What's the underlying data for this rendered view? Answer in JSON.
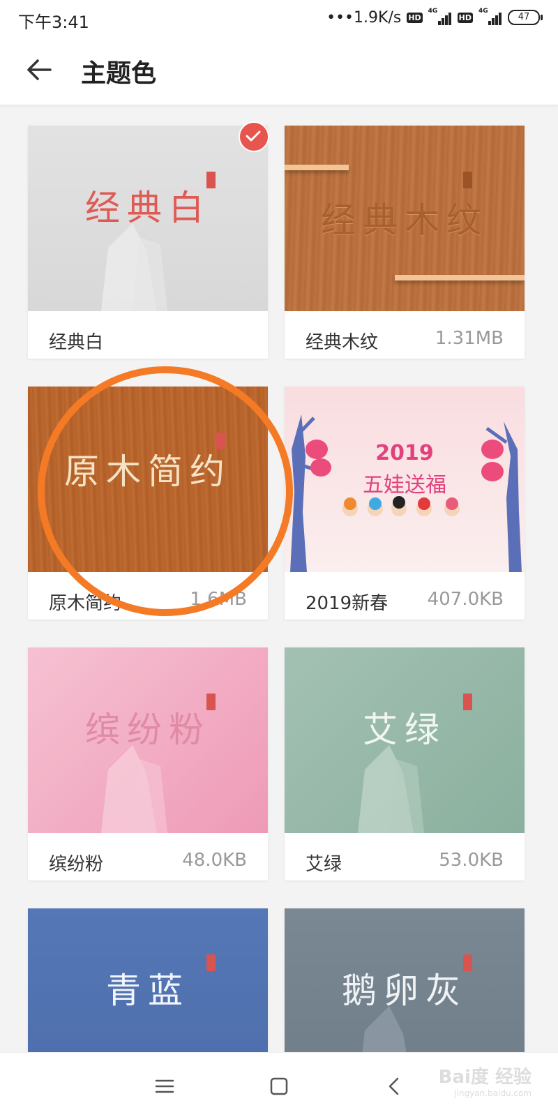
{
  "status_bar": {
    "time": "下午3:41",
    "network_speed": "•••1.9K/s",
    "hd_badge": "HD",
    "signal_label": "4G",
    "battery": "47"
  },
  "header": {
    "title": "主题色",
    "back_icon": "arrow-left-icon"
  },
  "themes": [
    {
      "thumb_text": "经典白",
      "name": "经典白",
      "size": "",
      "selected": true,
      "seal": "掌阅"
    },
    {
      "thumb_text": "经典木纹",
      "name": "经典木纹",
      "size": "1.31MB",
      "selected": false,
      "seal": "掌阅"
    },
    {
      "thumb_text": "原木简约",
      "name": "原木简约",
      "size": "1.6MB",
      "selected": false,
      "seal": "掌阅"
    },
    {
      "thumb_line1": "2019",
      "thumb_line2": "五娃送福",
      "name": "2019新春",
      "size": "407.0KB",
      "selected": false
    },
    {
      "thumb_text": "缤纷粉",
      "name": "缤纷粉",
      "size": "48.0KB",
      "selected": false,
      "seal": "掌阅"
    },
    {
      "thumb_text": "艾绿",
      "name": "艾绿",
      "size": "53.0KB",
      "selected": false,
      "seal": "掌阅"
    },
    {
      "thumb_text": "青蓝",
      "name": "青蓝",
      "size": "",
      "selected": false,
      "seal": "掌阅"
    },
    {
      "thumb_text": "鹅卵灰",
      "name": "鹅卵灰",
      "size": "",
      "selected": false,
      "seal": "掌阅"
    }
  ],
  "nav": {
    "menu_icon": "menu-icon",
    "home_icon": "home-square-icon",
    "back_icon": "back-chevron-icon"
  },
  "watermark": {
    "brand": "Bai度 经验",
    "url": "jingyan.baidu.com"
  },
  "colors": {
    "accent": "#e8544e",
    "highlight_circle": "#f47a25"
  }
}
